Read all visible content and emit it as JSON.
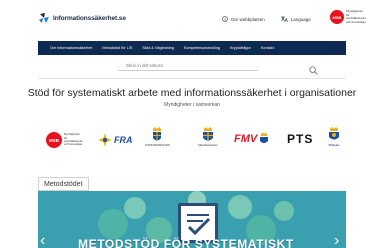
{
  "header": {
    "site_name": "Informationssäkerhet.se",
    "about_label": "Om webbplatsen",
    "language_label": "Language",
    "msb_abbrev": "MSB",
    "msb_name": "Myndigheten för samhällsskydd och beredskap"
  },
  "nav": {
    "items": [
      "Om informationssäkerhet",
      "Metodstöd för LIS",
      "Stöd & Vägledning",
      "Kompetensutveckling",
      "Kryptofrågor",
      "Kontakt"
    ]
  },
  "search": {
    "placeholder": "Skriv in ditt sökord"
  },
  "hero": {
    "title": "Stöd för systematiskt arbete med informationssäkerhet i organisationer",
    "subtitle": "Myndigheter i samverkan"
  },
  "agencies": {
    "msb": "MSB",
    "msb_name": "Myndigheten för samhällsskydd och beredskap",
    "fra": "FRA",
    "forsvarsmakten": "FÖRSVARSMAKTEN",
    "sakerhetspolisen": "Säkerhetspolisen",
    "fmv": "FMV",
    "pts": "PTS",
    "polisen": "Polisen"
  },
  "banner": {
    "tag": "Metodstödet",
    "title": "METODSTÖD FÖR SYSTEMATISKT",
    "prev_label": "‹",
    "next_label": "›"
  },
  "colors": {
    "nav_bg": "#0e2a52",
    "msb_red": "#e8121e",
    "banner_teal": "#3aa0b0"
  }
}
